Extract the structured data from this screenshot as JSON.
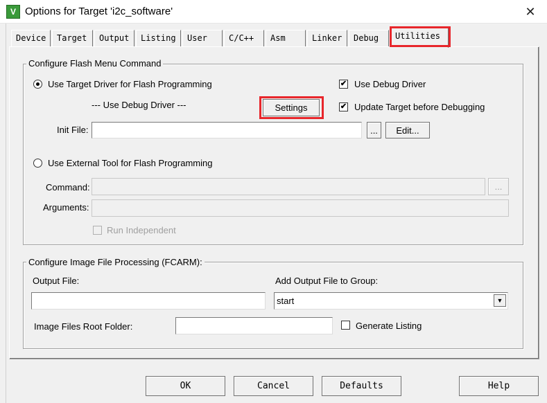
{
  "window": {
    "title": "Options for Target 'i2c_software'",
    "close_glyph": "✕",
    "icon_letter": "V"
  },
  "tabs": [
    "Device",
    "Target",
    "Output",
    "Listing",
    "User",
    "C/C++",
    "Asm",
    "Linker",
    "Debug",
    "Utilities"
  ],
  "active_tab": "Utilities",
  "flash": {
    "group_title": "Configure Flash Menu Command",
    "use_target_label": "Use Target Driver for Flash Programming",
    "driver_text": "--- Use Debug Driver ---",
    "settings_label": "Settings",
    "use_debug_driver_label": "Use Debug Driver",
    "use_debug_driver_checked": true,
    "update_target_label": "Update Target before Debugging",
    "update_target_checked": true,
    "init_file_label": "Init File:",
    "init_file_value": "",
    "browse_label": "...",
    "edit_label": "Edit...",
    "use_external_label": "Use External Tool for Flash Programming",
    "command_label": "Command:",
    "command_value": "",
    "command_browse_label": "...",
    "arguments_label": "Arguments:",
    "arguments_value": "",
    "run_independent_label": "Run Independent",
    "check_glyph": "✔"
  },
  "fcarm": {
    "group_title": "Configure Image File Processing (FCARM):",
    "output_file_label": "Output File:",
    "output_file_value": "",
    "add_output_label": "Add Output File  to Group:",
    "group_value": "start",
    "root_folder_label": "Image Files Root Folder:",
    "root_folder_value": "",
    "generate_listing_label": "Generate Listing",
    "generate_listing_checked": false,
    "dropdown_glyph": "▼"
  },
  "buttons": {
    "ok": "OK",
    "cancel": "Cancel",
    "defaults": "Defaults",
    "help": "Help"
  },
  "colors": {
    "highlight": "#e8262b",
    "app_icon": "#3a9a3a"
  }
}
